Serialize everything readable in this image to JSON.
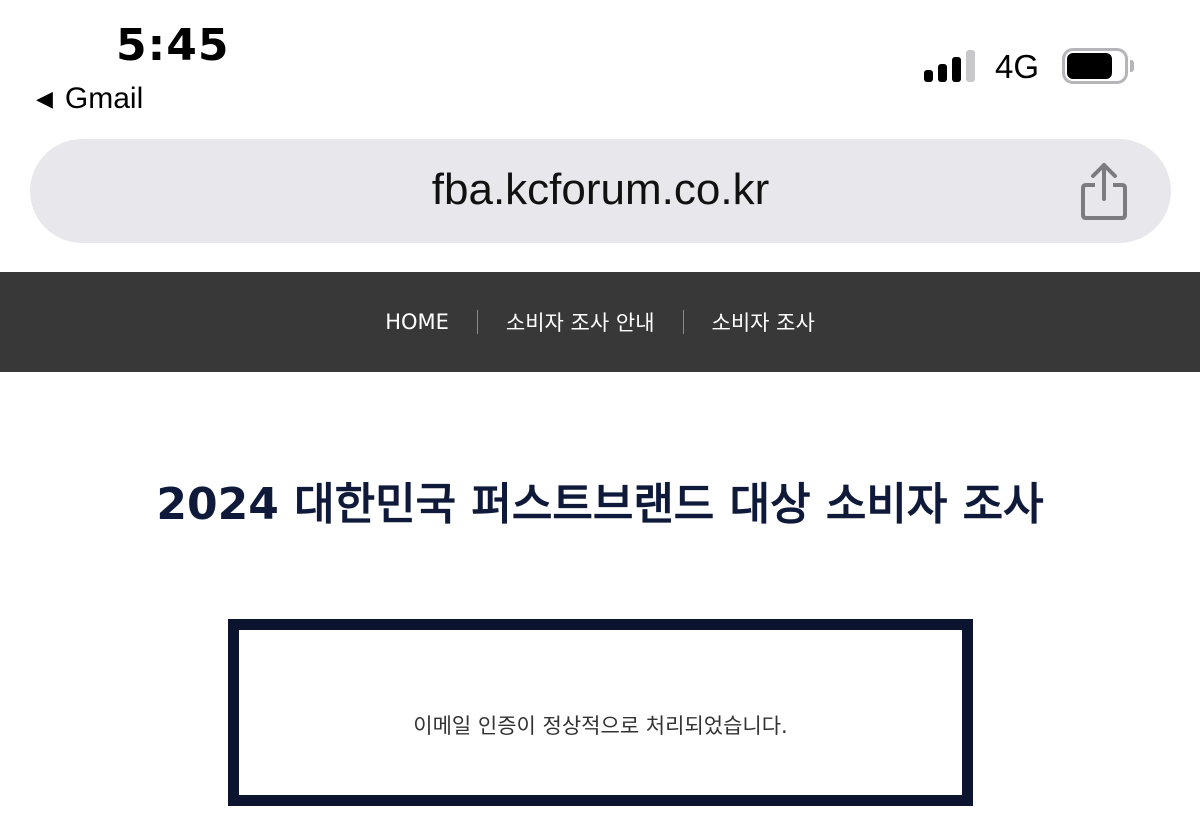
{
  "status_bar": {
    "time": "5:45",
    "back_app": "Gmail",
    "back_icon": "back-triangle-icon",
    "network": "4G",
    "signal_bars_filled": 3,
    "signal_bars_total": 4,
    "battery_level": 0.8
  },
  "browser": {
    "url": "fba.kcforum.co.kr",
    "share_icon": "share-icon"
  },
  "nav": {
    "items": [
      {
        "label": "HOME"
      },
      {
        "label": "소비자 조사 안내"
      },
      {
        "label": "소비자 조사"
      }
    ],
    "background": "#383838"
  },
  "main": {
    "title": "2024 대한민국 퍼스트브랜드 대상 소비자 조사",
    "message": "이메일 인증이 정상적으로 처리되었습니다."
  },
  "colors": {
    "title": "#0f1a3a",
    "box_border": "#0b1530"
  }
}
